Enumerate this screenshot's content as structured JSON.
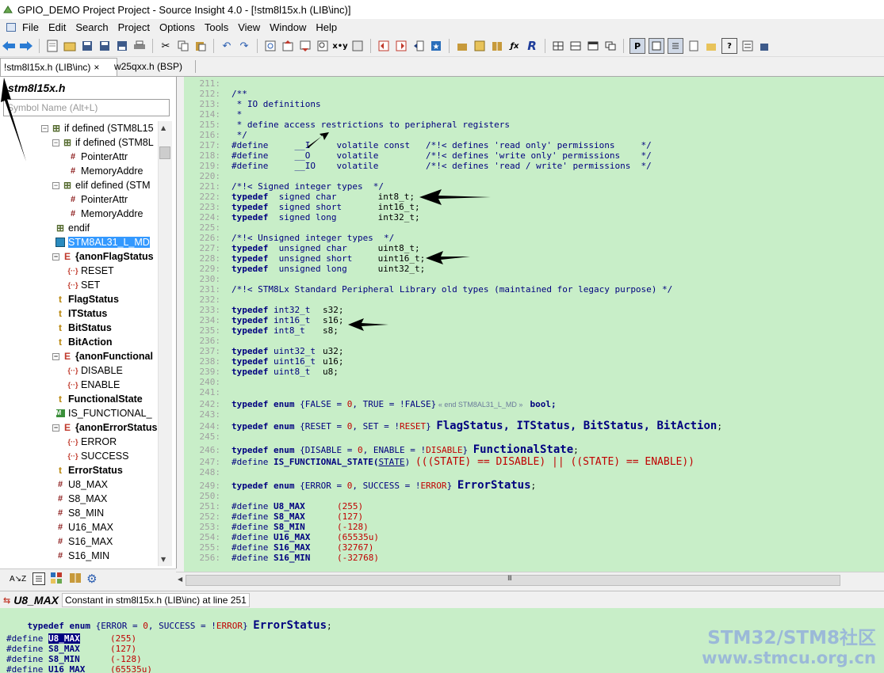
{
  "window": {
    "title": "GPIO_DEMO Project Project - Source Insight 4.0 - [!stm8l15x.h (LIB\\inc)]"
  },
  "menu": {
    "items": [
      "File",
      "Edit",
      "Search",
      "Project",
      "Options",
      "Tools",
      "View",
      "Window",
      "Help"
    ]
  },
  "tabs": [
    {
      "label": "!stm8l15x.h (LIB\\inc)",
      "close": "×",
      "active": true
    },
    {
      "label": "w25qxx.h (BSP)",
      "active": false
    }
  ],
  "symbol_panel": {
    "file": "stm8l15x.h",
    "search_placeholder": "Symbol Name (Alt+L)",
    "tree": [
      {
        "label": "if defined (STM8L15",
        "icon": "hash-icon"
      },
      {
        "label": "if defined (STM8L",
        "icon": "hash-icon"
      },
      {
        "label": "PointerAttr",
        "icon": "define-icon"
      },
      {
        "label": "MemoryAddre",
        "icon": "define-icon"
      },
      {
        "label": "elif defined (STM",
        "icon": "hash-icon"
      },
      {
        "label": "PointerAttr",
        "icon": "define-icon"
      },
      {
        "label": "MemoryAddre",
        "icon": "define-icon"
      },
      {
        "label": "endif",
        "icon": "hash-icon"
      },
      {
        "label": "STM8AL31_L_MD",
        "icon": "section-icon"
      },
      {
        "label": "{anonFlagStatus",
        "icon": "enum-icon"
      },
      {
        "label": "RESET",
        "icon": "constant-icon"
      },
      {
        "label": "SET",
        "icon": "constant-icon"
      },
      {
        "label": "FlagStatus",
        "icon": "typedef-icon"
      },
      {
        "label": "ITStatus",
        "icon": "typedef-icon"
      },
      {
        "label": "BitStatus",
        "icon": "typedef-icon"
      },
      {
        "label": "BitAction",
        "icon": "typedef-icon"
      },
      {
        "label": "{anonFunctional",
        "icon": "enum-icon"
      },
      {
        "label": "DISABLE",
        "icon": "constant-icon"
      },
      {
        "label": "ENABLE",
        "icon": "constant-icon"
      },
      {
        "label": "FunctionalState",
        "icon": "typedef-icon"
      },
      {
        "label": "IS_FUNCTIONAL_",
        "icon": "macro-icon"
      },
      {
        "label": "{anonErrorStatus",
        "icon": "enum-icon"
      },
      {
        "label": "ERROR",
        "icon": "constant-icon"
      },
      {
        "label": "SUCCESS",
        "icon": "constant-icon"
      },
      {
        "label": "ErrorStatus",
        "icon": "typedef-icon"
      },
      {
        "label": "U8_MAX",
        "icon": "define-icon"
      },
      {
        "label": "S8_MAX",
        "icon": "define-icon"
      },
      {
        "label": "S8_MIN",
        "icon": "define-icon"
      },
      {
        "label": "U16_MAX",
        "icon": "define-icon"
      },
      {
        "label": "S16_MAX",
        "icon": "define-icon"
      },
      {
        "label": "S16_MIN",
        "icon": "define-icon"
      }
    ]
  },
  "code": {
    "line_numbers": [
      "211:",
      "212:",
      "213:",
      "214:",
      "215:",
      "216:",
      "217:",
      "218:",
      "219:",
      "220:",
      "221:",
      "222:",
      "223:",
      "224:",
      "225:",
      "226:",
      "227:",
      "228:",
      "229:",
      "230:",
      "231:",
      "232:",
      "233:",
      "234:",
      "235:",
      "236:",
      "237:",
      "238:",
      "239:",
      "240:",
      "241:",
      "242:",
      "243:",
      "244:",
      "245:",
      "246:",
      "247:",
      "248:",
      "249:",
      "250:",
      "251:",
      "252:",
      "253:",
      "254:",
      "255:",
      "256:"
    ],
    "l212": "/**",
    "l213": " * IO definitions",
    "l214": " *",
    "l215": " * define access restrictions to peripheral registers",
    "l216": " */",
    "d217": "#define     __I     volatile const   /*!< defines 'read only' permissions     */",
    "d218": "#define     __O     volatile         /*!< defines 'write only' permissions    */",
    "d219": "#define     __IO    volatile         /*!< defines 'read / write' permissions  */",
    "l221": "/*!< Signed integer types  */",
    "l226": "/*!< Unsigned integer types  */",
    "l231": "/*!< STM8Lx Standard Peripheral Library old types (maintained for legacy purpose) */",
    "typedef_kw": "typedef",
    "t222": [
      "signed char",
      "int8_t;"
    ],
    "t223": [
      "signed short",
      "int16_t;"
    ],
    "t224": [
      "signed long",
      "int32_t;"
    ],
    "t227": [
      "unsigned char",
      "uint8_t;"
    ],
    "t228": [
      "unsigned short",
      "uint16_t;"
    ],
    "t229": [
      "unsigned long",
      "uint32_t;"
    ],
    "t233": [
      "int32_t",
      "s32;"
    ],
    "t234": [
      "int16_t",
      "s16;"
    ],
    "t235": [
      "int8_t",
      "s8;"
    ],
    "t237": [
      "uint32_t",
      "u32;"
    ],
    "t238": [
      "uint16_t",
      "u16;"
    ],
    "t239": [
      "uint8_t",
      "u8;"
    ],
    "enum_kw": "enum",
    "e242": {
      "a": "{FALSE = ",
      "n0": "0",
      "b": ", TRUE = !FALSE}",
      "note": " « end STM8AL31_L_MD » ",
      "c": " bool;"
    },
    "e244": {
      "a": "{RESET = ",
      "n0": "0",
      "b": ", SET = !",
      "neg": "RESET",
      "c": "} ",
      "name": "FlagStatus, ITStatus, BitStatus, BitAction",
      "end": ";"
    },
    "e246": {
      "a": "{DISABLE = ",
      "n0": "0",
      "b": ", ENABLE = !",
      "neg": "DISABLE",
      "c": "} ",
      "name": "FunctionalState",
      "end": ";"
    },
    "d247": {
      "a": "#define ",
      "m": "IS_FUNCTIONAL_STATE(",
      "p": "STATE",
      "b": ") ",
      "c": "(((STATE) == DISABLE) || ((STATE) == ENABLE))"
    },
    "e249": {
      "a": "{ERROR = ",
      "n0": "0",
      "b": ", SUCCESS = !",
      "neg": "ERROR",
      "c": "} ",
      "name": "ErrorStatus",
      "end": ";"
    },
    "defs": [
      {
        "name": "U8_MAX",
        "val": "(255)"
      },
      {
        "name": "S8_MAX",
        "val": "(127)"
      },
      {
        "name": "S8_MIN",
        "val": "(-128)"
      },
      {
        "name": "U16_MAX",
        "val": "(65535u)"
      },
      {
        "name": "S16_MAX",
        "val": "(32767)"
      },
      {
        "name": "S16_MIN",
        "val": "(-32768)"
      }
    ],
    "define_kw": "#define",
    "hscroll_grip": "III"
  },
  "context": {
    "symbol": "U8_MAX",
    "description": "Constant in stm8l15x.h (LIB\\inc) at line 251",
    "line1": {
      "a": "typedef enum ",
      "b": "{ERROR = ",
      "n0": "0",
      "c": ", SUCCESS = !",
      "neg": "ERROR",
      "d": "} ",
      "name": "ErrorStatus",
      "end": ";"
    },
    "defs": [
      {
        "name": "U8_MAX",
        "val": "(255)"
      },
      {
        "name": "S8_MAX",
        "val": "(127)"
      },
      {
        "name": "S8_MIN",
        "val": "(-128)"
      },
      {
        "name": "U16_MAX",
        "val": "(65535u)"
      }
    ]
  },
  "watermark": {
    "line1": "STM32/STM8社区",
    "line2": "www.stmcu.org.cn"
  },
  "colors": {
    "code_bg": "#c8eec8",
    "keyword": "#00007f",
    "number": "#c00000",
    "selection": "#3399ff"
  }
}
